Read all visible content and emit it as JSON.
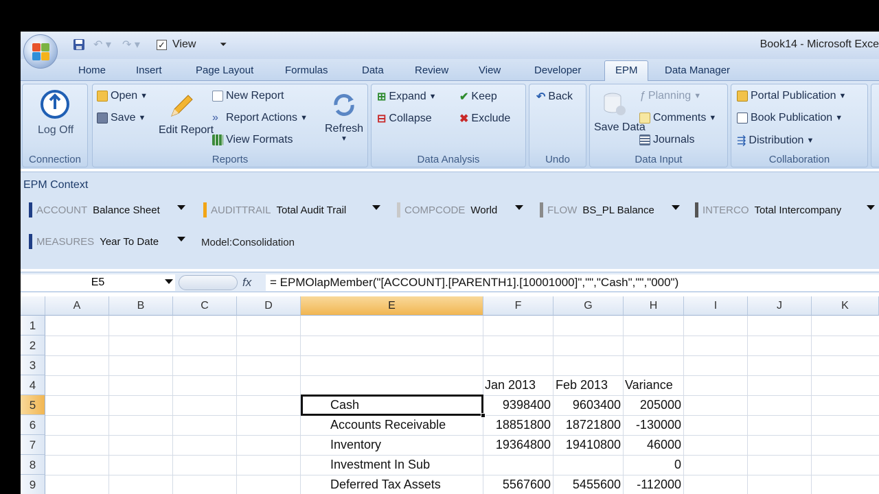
{
  "window": {
    "title": "Book14 - Microsoft Exce"
  },
  "qat": {
    "view_label": "View"
  },
  "tabs": [
    "Home",
    "Insert",
    "Page Layout",
    "Formulas",
    "Data",
    "Review",
    "View",
    "Developer",
    "EPM",
    "Data Manager"
  ],
  "active_tab": "EPM",
  "ribbon": {
    "connection": {
      "label": "Connection",
      "log_off": "Log Off"
    },
    "reports": {
      "label": "Reports",
      "open": "Open",
      "save": "Save",
      "edit_report": "Edit Report",
      "new_report": "New Report",
      "report_actions": "Report Actions",
      "view_formats": "View Formats",
      "refresh": "Refresh"
    },
    "data_analysis": {
      "label": "Data Analysis",
      "expand": "Expand",
      "collapse": "Collapse",
      "keep": "Keep",
      "exclude": "Exclude"
    },
    "undo": {
      "label": "Undo",
      "back": "Back"
    },
    "data_input": {
      "label": "Data Input",
      "save_data": "Save Data",
      "planning": "Planning",
      "comments": "Comments",
      "journals": "Journals"
    },
    "collaboration": {
      "label": "Collaboration",
      "portal_publication": "Portal Publication",
      "book_publication": "Book Publication",
      "distribution": "Distribution"
    }
  },
  "epm_context": {
    "title": "EPM Context",
    "dimensions": [
      {
        "name": "ACCOUNT",
        "value": "Balance Sheet",
        "color": "#1f3e86"
      },
      {
        "name": "AUDITTRAIL",
        "value": "Total Audit Trail",
        "color": "#f2a516"
      },
      {
        "name": "COMPCODE",
        "value": "World",
        "color": "#c9c9c9"
      },
      {
        "name": "FLOW",
        "value": "BS_PL Balance",
        "color": "#8a8a8a"
      },
      {
        "name": "INTERCO",
        "value": "Total Intercompany",
        "color": "#555555"
      },
      {
        "name": "MEASURES",
        "value": "Year To Date",
        "color": "#1f3e86"
      }
    ],
    "model": "Model:Consolidation"
  },
  "formula_bar": {
    "name_box": "E5",
    "fx": "fx",
    "formula": "= EPMOlapMember(\"[ACCOUNT].[PARENTH1].[10001000]\",\"\",\"Cash\",\"\",\"000\")"
  },
  "sheet": {
    "columns": [
      "A",
      "B",
      "C",
      "D",
      "E",
      "F",
      "G",
      "H",
      "I",
      "J",
      "K"
    ],
    "rows": [
      "1",
      "2",
      "3",
      "4",
      "5",
      "6",
      "7",
      "8",
      "9"
    ],
    "header_row": {
      "F": "Jan 2013",
      "G": "Feb 2013",
      "H": "Variance"
    },
    "data": [
      {
        "label": "Cash",
        "F": "9398400",
        "G": "9603400",
        "H": "205000"
      },
      {
        "label": "Accounts Receivable",
        "F": "18851800",
        "G": "18721800",
        "H": "-130000"
      },
      {
        "label": "Inventory",
        "F": "19364800",
        "G": "19410800",
        "H": "46000"
      },
      {
        "label": "Investment In Sub",
        "F": "",
        "G": "",
        "H": "0"
      },
      {
        "label": "Deferred Tax Assets",
        "F": "5567600",
        "G": "5455600",
        "H": "-112000"
      }
    ]
  }
}
